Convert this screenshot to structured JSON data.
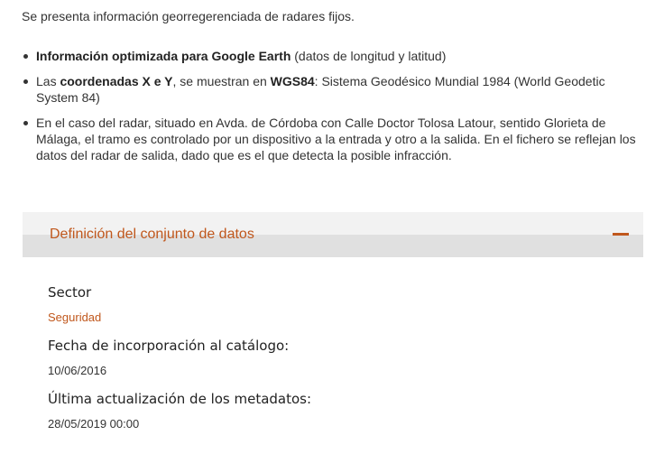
{
  "intro": "Se presenta información georregerenciada de radares fijos.",
  "bullets": [
    {
      "bold": "Información optimizada para Google Earth",
      "rest": " (datos de longitud y latitud)"
    },
    {
      "pre": "Las ",
      "bold1": "coordenadas X e Y",
      "mid": ", se muestran en ",
      "bold2": "WGS84",
      "rest": ": Sistema Geodésico Mundial 1984 (World Geodetic System 84)"
    },
    {
      "text": "En el caso del radar, situado en Avda. de Córdoba con Calle Doctor Tolosa Latour, sentido Glorieta de Málaga, el tramo es controlado por un dispositivo a la entrada y otro a la salida. En el fichero se reflejan los datos del radar de salida, dado que es el que detecta la posible infracción."
    }
  ],
  "accordion": {
    "title": "Definición del conjunto de datos",
    "icon": "minus-icon"
  },
  "metadata": {
    "sector_label": "Sector",
    "sector_value": "Seguridad",
    "fecha_label": "Fecha de incorporación al catálogo:",
    "fecha_value": "10/06/2016",
    "actualizacion_label": "Última actualización de los metadatos:",
    "actualizacion_value": "28/05/2019 00:00"
  },
  "colors": {
    "accent": "#c0571c",
    "text": "#333333",
    "accordion_bg_top": "#f2f2f2",
    "accordion_bg_bottom": "#e0e0e0"
  }
}
